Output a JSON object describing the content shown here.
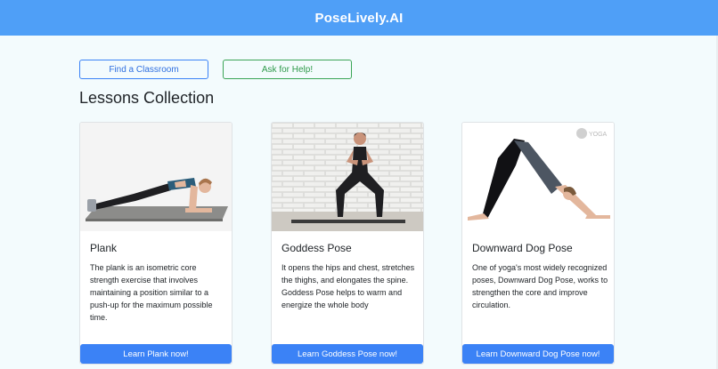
{
  "header": {
    "title": "PoseLively.AI",
    "color": "#4f9ff7"
  },
  "actions": {
    "find_classroom": "Find a Classroom",
    "ask_help": "Ask for Help!"
  },
  "section": {
    "title": "Lessons Collection"
  },
  "cards": [
    {
      "title": "Plank",
      "description": "The plank is an isometric core strength exercise that involves maintaining a position similar to a push-up for the maximum possible time.",
      "button": "Learn Plank now!",
      "image": "plank-pose-photo"
    },
    {
      "title": "Goddess Pose",
      "description": "It opens the hips and chest, stretches the thighs, and elongates the spine. Goddess Pose helps to warm and energize the whole body",
      "button": "Learn Goddess Pose now!",
      "image": "goddess-pose-photo"
    },
    {
      "title": "Downward Dog Pose",
      "description": "One of yoga's most widely recognized poses, Downward Dog Pose, works to strengthen the core and improve circulation.",
      "button": "Learn Downward Dog Pose now!",
      "image": "downward-dog-pose-photo",
      "watermark": "YOGA"
    }
  ],
  "colors": {
    "primary": "#3b82f6",
    "success": "#3aa455",
    "background": "#f3fbfd"
  }
}
